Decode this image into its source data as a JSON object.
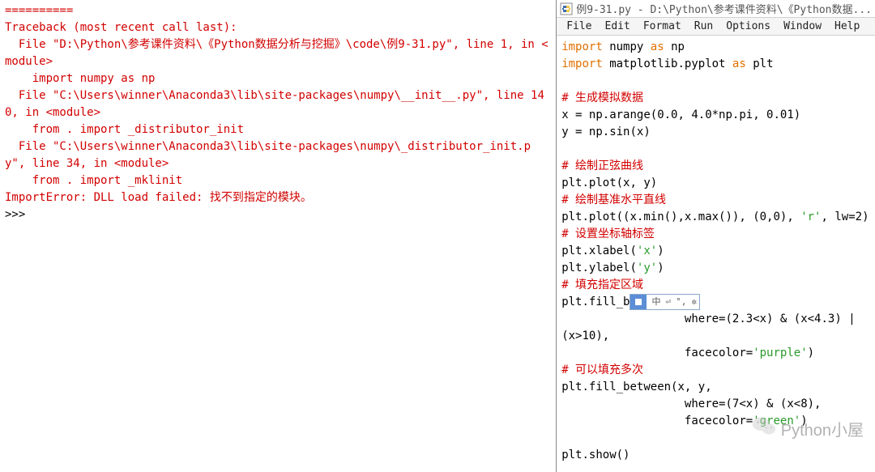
{
  "left": {
    "separator": "==========",
    "trace_header": "Traceback (most recent call last):",
    "frame1": "  File \"D:\\Python\\参考课件资料\\《Python数据分析与挖掘》\\code\\例9-31.py\", line 1, in <module>",
    "frame1_code": "    import numpy as np",
    "frame2": "  File \"C:\\Users\\winner\\Anaconda3\\lib\\site-packages\\numpy\\__init__.py\", line 140, in <module>",
    "frame2_code": "    from . import _distributor_init",
    "frame3": "  File \"C:\\Users\\winner\\Anaconda3\\lib\\site-packages\\numpy\\_distributor_init.py\", line 34, in <module>",
    "frame3_code": "    from . import _mklinit",
    "error": "ImportError: DLL load failed: 找不到指定的模块。",
    "prompt": ">>> "
  },
  "right": {
    "title": "例9-31.py - D:\\Python\\参考课件资料\\《Python数据...",
    "menu": [
      "File",
      "Edit",
      "Format",
      "Run",
      "Options",
      "Window",
      "Help"
    ],
    "lines": [
      [
        [
          "kw",
          "import"
        ],
        [
          "black",
          " numpy "
        ],
        [
          "kw",
          "as"
        ],
        [
          "black",
          " np"
        ]
      ],
      [
        [
          "kw",
          "import"
        ],
        [
          "black",
          " matplotlib.pyplot "
        ],
        [
          "kw",
          "as"
        ],
        [
          "black",
          " plt"
        ]
      ],
      [
        [
          "black",
          ""
        ]
      ],
      [
        [
          "cmt",
          "# 生成模拟数据"
        ]
      ],
      [
        [
          "black",
          "x = np.arange(0.0, 4.0*np.pi, 0.01)"
        ]
      ],
      [
        [
          "black",
          "y = np.sin(x)"
        ]
      ],
      [
        [
          "black",
          ""
        ]
      ],
      [
        [
          "cmt",
          "# 绘制正弦曲线"
        ]
      ],
      [
        [
          "black",
          "plt.plot(x, y)"
        ]
      ],
      [
        [
          "cmt",
          "# 绘制基准水平直线"
        ]
      ],
      [
        [
          "black",
          "plt.plot((x.min(),x.max()), (0,0), "
        ],
        [
          "str",
          "'r'"
        ],
        [
          "black",
          ", lw=2)"
        ]
      ],
      [
        [
          "cmt",
          "# 设置坐标轴标签"
        ]
      ],
      [
        [
          "black",
          "plt.xlabel("
        ],
        [
          "str",
          "'x'"
        ],
        [
          "black",
          ")"
        ]
      ],
      [
        [
          "black",
          "plt.ylabel("
        ],
        [
          "str",
          "'y'"
        ],
        [
          "black",
          ")"
        ]
      ],
      [
        [
          "cmt",
          "# 填充指定区域"
        ]
      ],
      [
        [
          "black",
          "plt.fill_b"
        ],
        [
          "ime",
          ""
        ]
      ],
      [
        [
          "black",
          "                  where=(2.3<x) & (x<4.3) | (x>10),"
        ]
      ],
      [
        [
          "black",
          "                  facecolor="
        ],
        [
          "str",
          "'purple'"
        ],
        [
          "black",
          ")"
        ]
      ],
      [
        [
          "cmt",
          "# 可以填充多次"
        ]
      ],
      [
        [
          "black",
          "plt.fill_between(x, y,"
        ]
      ],
      [
        [
          "black",
          "                  where=(7<x) & (x<8),"
        ]
      ],
      [
        [
          "black",
          "                  facecolor="
        ],
        [
          "str",
          "'green'"
        ],
        [
          "black",
          ")"
        ]
      ],
      [
        [
          "black",
          ""
        ]
      ],
      [
        [
          "black",
          "plt.show()"
        ]
      ]
    ],
    "ime_glyphs": [
      "中",
      "⏎",
      "°,",
      "✲"
    ]
  },
  "watermark": {
    "text": "Python小屋"
  }
}
